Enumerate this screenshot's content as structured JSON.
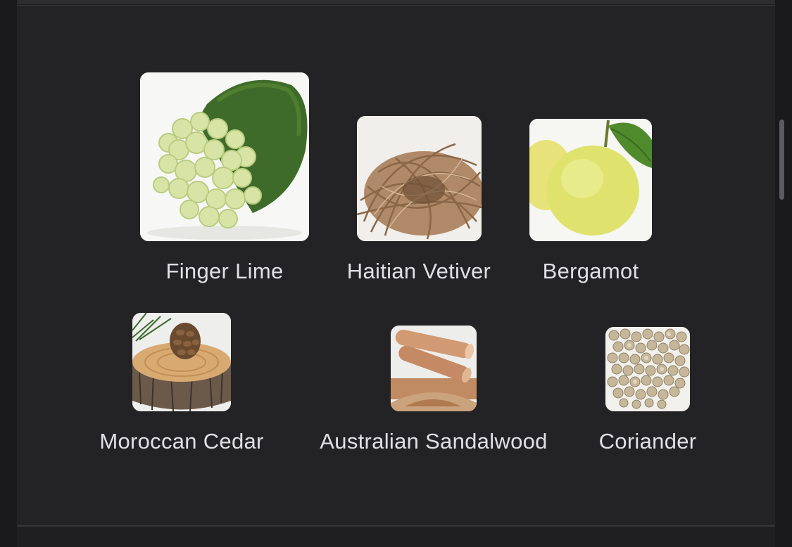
{
  "ingredients": [
    {
      "name": "Finger Lime",
      "image": "finger-lime-photo"
    },
    {
      "name": "Haitian Vetiver",
      "image": "vetiver-root-photo"
    },
    {
      "name": "Bergamot",
      "image": "bergamot-fruit-photo"
    },
    {
      "name": "Moroccan Cedar",
      "image": "cedar-log-pinecone-photo"
    },
    {
      "name": "Australian Sandalwood",
      "image": "sandalwood-sticks-photo"
    },
    {
      "name": "Coriander",
      "image": "coriander-seeds-photo"
    }
  ]
}
